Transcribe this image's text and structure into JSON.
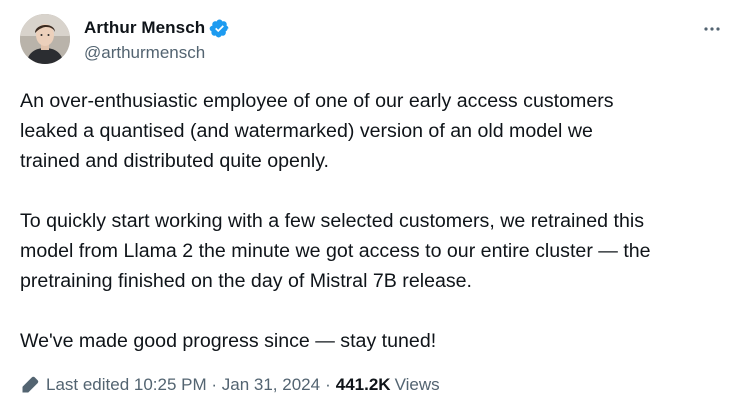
{
  "author": {
    "display_name": "Arthur Mensch",
    "handle": "@arthurmensch",
    "verified": true
  },
  "icons": {
    "verified": "verified-badge-icon",
    "more": "more-horizontal-icon",
    "edit": "pencil-icon"
  },
  "colors": {
    "text": "#0f1419",
    "secondary": "#536471",
    "verified_blue": "#1d9bf0"
  },
  "tweet": {
    "paragraphs": [
      "An over-enthusiastic employee of one of our early access customers\nleaked a quantised (and watermarked) version of an old model we\ntrained and distributed quite openly.",
      "To quickly start working with a few selected customers, we retrained this\nmodel from Llama 2 the minute we got access to our entire cluster — the\npretraining finished on the day of Mistral 7B release.",
      "We've made good progress since — stay tuned!"
    ]
  },
  "meta": {
    "edited_label": "Last edited 10:25 PM · Jan 31, 2024",
    "separator": "·",
    "views_count": "441.2K",
    "views_label": "Views"
  }
}
